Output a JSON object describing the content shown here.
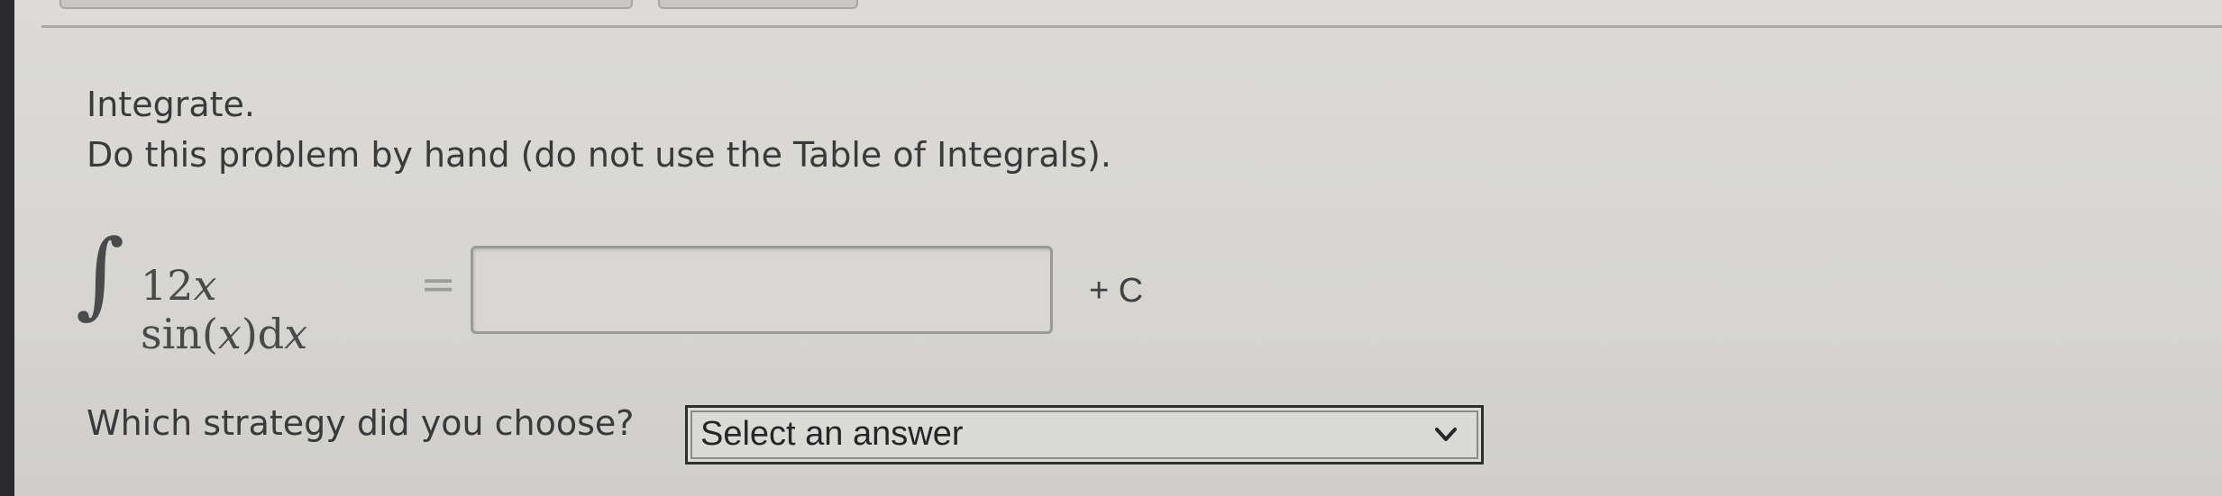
{
  "question": {
    "title": "Integrate.",
    "instruction": "Do this problem by hand (do not use the Table of Integrals)."
  },
  "integral": {
    "sign": "∫",
    "coefficient": "12",
    "var1": "x",
    "function": " sin(",
    "var2": "x",
    "close": ")d",
    "var3": "x",
    "equals": "=",
    "answer_value": "",
    "constant": "+ C"
  },
  "strategy": {
    "label": "Which strategy did you choose?",
    "selected": "Select an answer"
  },
  "icons": {
    "dropdown": "chevron-down-icon"
  }
}
